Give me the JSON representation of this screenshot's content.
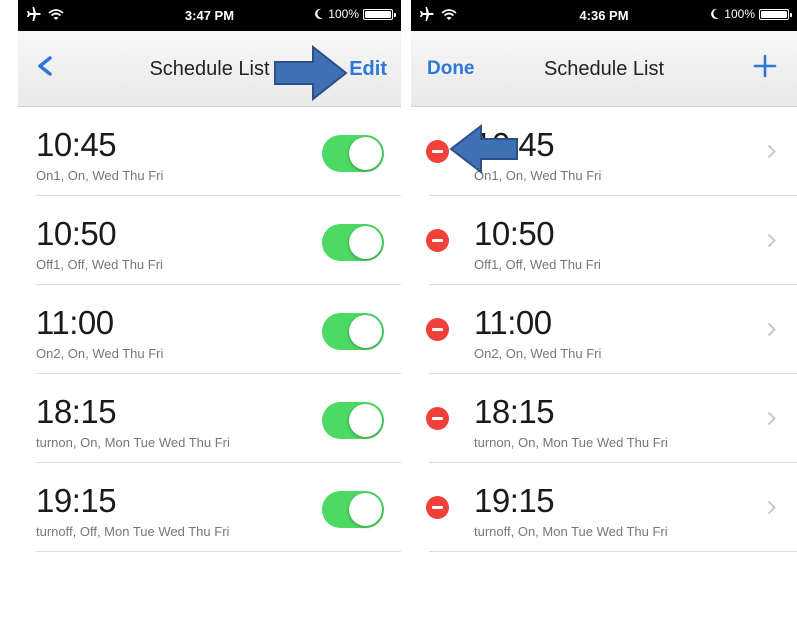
{
  "left_screen": {
    "status": {
      "time": "3:47 PM",
      "battery": "100%"
    },
    "nav": {
      "back_label": "<",
      "title": "Schedule List",
      "edit_label": "Edit"
    },
    "rows": [
      {
        "time": "10:45",
        "detail": "On1, On, Wed Thu Fri",
        "enabled": true
      },
      {
        "time": "10:50",
        "detail": "Off1, Off, Wed Thu Fri",
        "enabled": true
      },
      {
        "time": "11:00",
        "detail": "On2, On, Wed Thu Fri",
        "enabled": true
      },
      {
        "time": "18:15",
        "detail": "turnon, On, Mon Tue Wed Thu Fri",
        "enabled": true
      },
      {
        "time": "19:15",
        "detail": "turnoff, Off, Mon Tue Wed Thu Fri",
        "enabled": true
      }
    ]
  },
  "right_screen": {
    "status": {
      "time": "4:36 PM",
      "battery": "100%"
    },
    "nav": {
      "done_label": "Done",
      "title": "Schedule List"
    },
    "rows": [
      {
        "time": "10:45",
        "detail": "On1, On, Wed Thu Fri"
      },
      {
        "time": "10:50",
        "detail": "Off1, Off, Wed Thu Fri"
      },
      {
        "time": "11:00",
        "detail": "On2, On, Wed Thu Fri"
      },
      {
        "time": "18:15",
        "detail": "turnon, On, Mon Tue Wed Thu Fri"
      },
      {
        "time": "19:15",
        "detail": "turnoff, On, Mon Tue Wed Thu Fri"
      }
    ]
  },
  "icons": {
    "status_left": [
      "airplane-icon",
      "wifi-icon"
    ],
    "status_right": [
      "moon-icon",
      "battery-icon"
    ],
    "nav": [
      "back-chevron-icon",
      "plus-icon"
    ],
    "rows": [
      "toggle-switch",
      "delete-minus-icon",
      "chevron-right-icon"
    ],
    "annotations": [
      "arrow-right-icon",
      "arrow-left-icon"
    ]
  },
  "colors": {
    "accent": "#2e77d6",
    "toggle_on": "#4cd964",
    "delete": "#f0403a",
    "annotation_arrow": "#3e70b3"
  }
}
